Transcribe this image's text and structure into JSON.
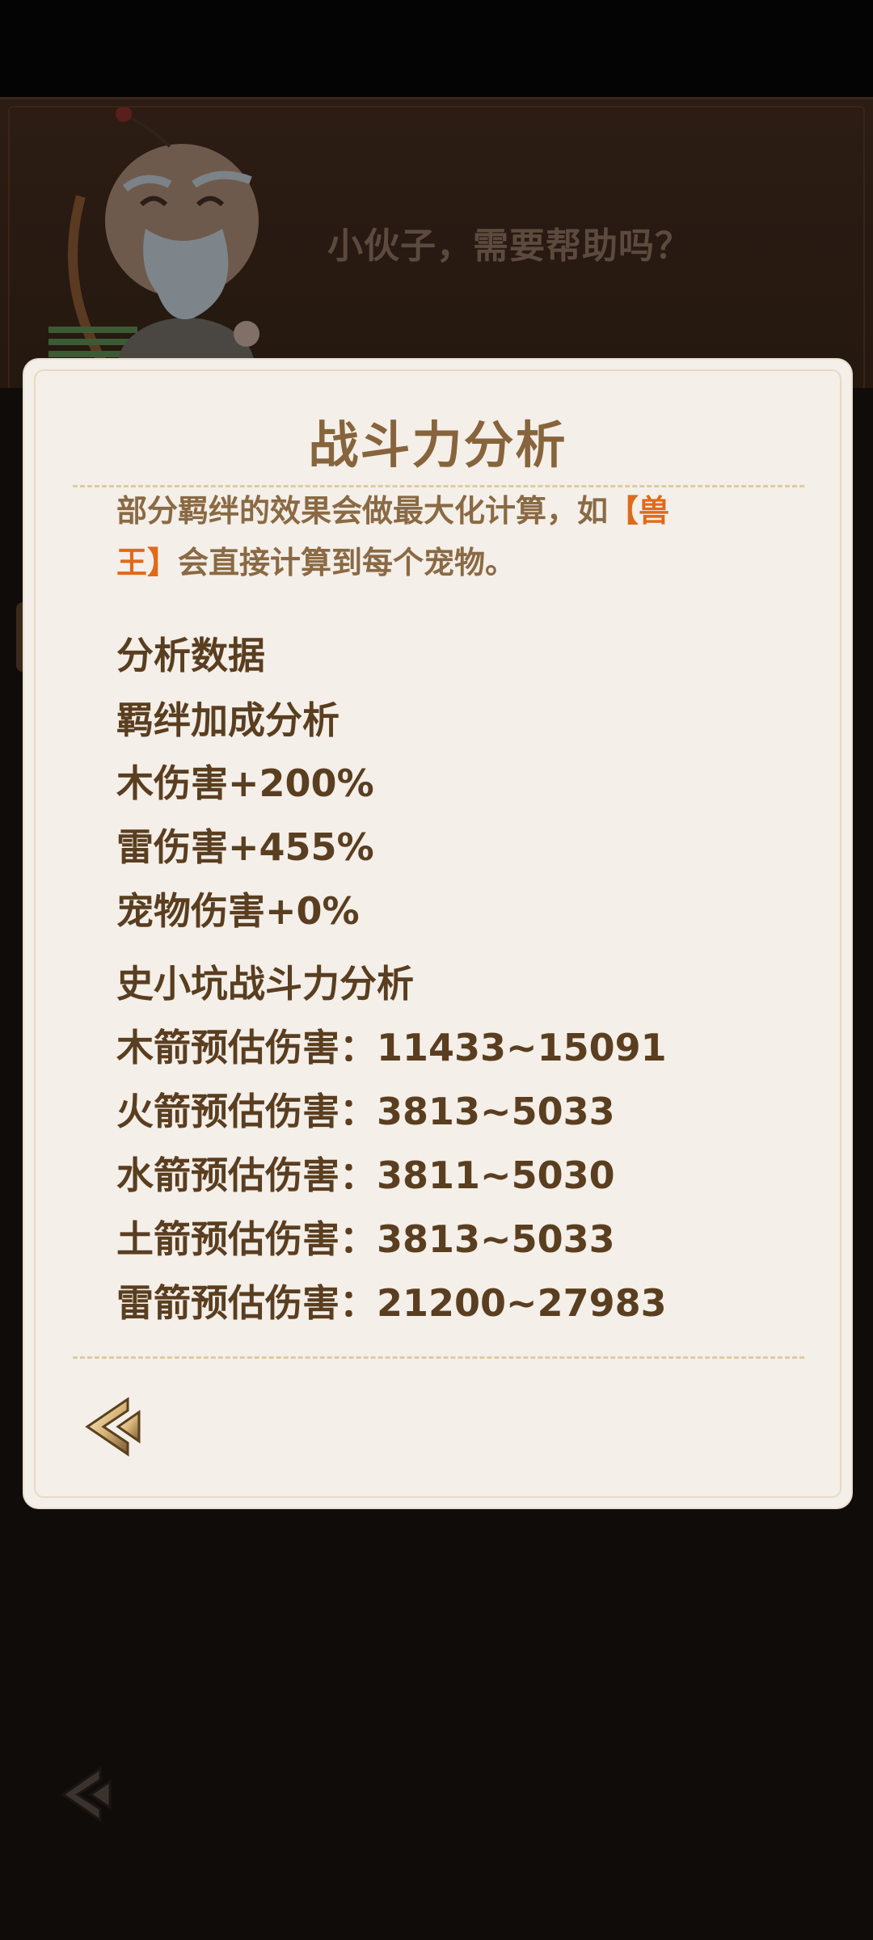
{
  "header": {
    "npc_speech": "小伙子，需要帮助吗？"
  },
  "dialog": {
    "title": "战斗力分析",
    "note_prefix": "部分羁绊的效果会做最大化计算，如",
    "note_highlight_1": "【兽",
    "note_highlight_2": "王】",
    "note_suffix": "会直接计算到每个宠物。",
    "section_data_title": "分析数据",
    "bond_title": "羁绊加成分析",
    "bonds": [
      "木伤害+200%",
      "雷伤害+455%",
      "宠物伤害+0%"
    ],
    "character_title": "史小坑战斗力分析",
    "damage_rows": [
      "木箭预估伤害：11433~15091",
      "火箭预估伤害：3813~5033",
      "水箭预估伤害：3811~5030",
      "土箭预估伤害：3813~5033",
      "雷箭预估伤害：21200~27983"
    ]
  },
  "colors": {
    "panel_bg": "#f4efe8",
    "title": "#87643c",
    "highlight": "#e06a1a",
    "text": "#5a3e20"
  },
  "icons": {
    "back": "double-chevron-left-icon",
    "npc": "old-archer-npc-avatar"
  }
}
